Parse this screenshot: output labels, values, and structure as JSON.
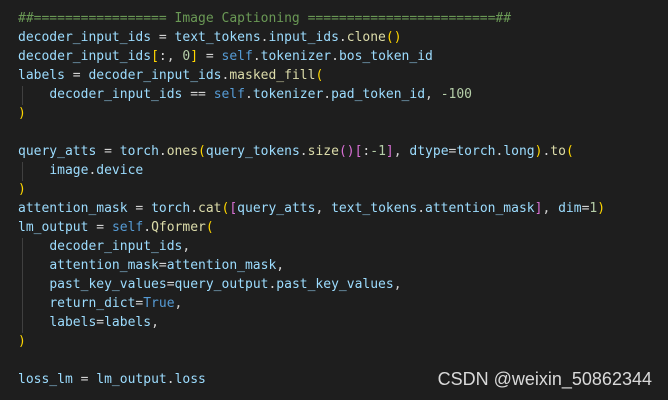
{
  "code": {
    "language": "python",
    "lines": [
      [
        {
          "t": "##================= Image Captioning ========================##",
          "c": "cm"
        }
      ],
      [
        {
          "t": "decoder_input_ids",
          "c": "vr"
        },
        {
          "t": " = ",
          "c": "op"
        },
        {
          "t": "text_tokens",
          "c": "vr"
        },
        {
          "t": ".",
          "c": "op"
        },
        {
          "t": "input_ids",
          "c": "vr"
        },
        {
          "t": ".",
          "c": "op"
        },
        {
          "t": "clone",
          "c": "fn"
        },
        {
          "t": "()",
          "c": "br1"
        }
      ],
      [
        {
          "t": "decoder_input_ids",
          "c": "vr"
        },
        {
          "t": "[",
          "c": "br1"
        },
        {
          "t": ":, ",
          "c": "op"
        },
        {
          "t": "0",
          "c": "nm"
        },
        {
          "t": "]",
          "c": "br1"
        },
        {
          "t": " = ",
          "c": "op"
        },
        {
          "t": "self",
          "c": "sf"
        },
        {
          "t": ".",
          "c": "op"
        },
        {
          "t": "tokenizer",
          "c": "vr"
        },
        {
          "t": ".",
          "c": "op"
        },
        {
          "t": "bos_token_id",
          "c": "vr"
        }
      ],
      [
        {
          "t": "labels",
          "c": "vr"
        },
        {
          "t": " = ",
          "c": "op"
        },
        {
          "t": "decoder_input_ids",
          "c": "vr"
        },
        {
          "t": ".",
          "c": "op"
        },
        {
          "t": "masked_fill",
          "c": "fn"
        },
        {
          "t": "(",
          "c": "br1"
        }
      ],
      [
        {
          "t": "    ",
          "c": "op"
        },
        {
          "t": "decoder_input_ids",
          "c": "vr"
        },
        {
          "t": " == ",
          "c": "op"
        },
        {
          "t": "self",
          "c": "sf"
        },
        {
          "t": ".",
          "c": "op"
        },
        {
          "t": "tokenizer",
          "c": "vr"
        },
        {
          "t": ".",
          "c": "op"
        },
        {
          "t": "pad_token_id",
          "c": "vr"
        },
        {
          "t": ", ",
          "c": "op"
        },
        {
          "t": "-100",
          "c": "nm"
        }
      ],
      [
        {
          "t": ")",
          "c": "br1"
        }
      ],
      [],
      [
        {
          "t": "query_atts",
          "c": "vr"
        },
        {
          "t": " = ",
          "c": "op"
        },
        {
          "t": "torch",
          "c": "vr"
        },
        {
          "t": ".",
          "c": "op"
        },
        {
          "t": "ones",
          "c": "fn"
        },
        {
          "t": "(",
          "c": "br1"
        },
        {
          "t": "query_tokens",
          "c": "vr"
        },
        {
          "t": ".",
          "c": "op"
        },
        {
          "t": "size",
          "c": "fn"
        },
        {
          "t": "()",
          "c": "br2"
        },
        {
          "t": "[",
          "c": "br2"
        },
        {
          "t": ":",
          "c": "op"
        },
        {
          "t": "-1",
          "c": "nm"
        },
        {
          "t": "]",
          "c": "br2"
        },
        {
          "t": ", ",
          "c": "op"
        },
        {
          "t": "dtype",
          "c": "pm"
        },
        {
          "t": "=",
          "c": "op"
        },
        {
          "t": "torch",
          "c": "vr"
        },
        {
          "t": ".",
          "c": "op"
        },
        {
          "t": "long",
          "c": "vr"
        },
        {
          "t": ")",
          "c": "br1"
        },
        {
          "t": ".",
          "c": "op"
        },
        {
          "t": "to",
          "c": "fn"
        },
        {
          "t": "(",
          "c": "br1"
        }
      ],
      [
        {
          "t": "    ",
          "c": "op"
        },
        {
          "t": "image",
          "c": "vr"
        },
        {
          "t": ".",
          "c": "op"
        },
        {
          "t": "device",
          "c": "vr"
        }
      ],
      [
        {
          "t": ")",
          "c": "br1"
        }
      ],
      [
        {
          "t": "attention_mask",
          "c": "vr"
        },
        {
          "t": " = ",
          "c": "op"
        },
        {
          "t": "torch",
          "c": "vr"
        },
        {
          "t": ".",
          "c": "op"
        },
        {
          "t": "cat",
          "c": "fn"
        },
        {
          "t": "(",
          "c": "br1"
        },
        {
          "t": "[",
          "c": "br2"
        },
        {
          "t": "query_atts",
          "c": "vr"
        },
        {
          "t": ", ",
          "c": "op"
        },
        {
          "t": "text_tokens",
          "c": "vr"
        },
        {
          "t": ".",
          "c": "op"
        },
        {
          "t": "attention_mask",
          "c": "vr"
        },
        {
          "t": "]",
          "c": "br2"
        },
        {
          "t": ", ",
          "c": "op"
        },
        {
          "t": "dim",
          "c": "pm"
        },
        {
          "t": "=",
          "c": "op"
        },
        {
          "t": "1",
          "c": "nm"
        },
        {
          "t": ")",
          "c": "br1"
        }
      ],
      [
        {
          "t": "lm_output",
          "c": "vr"
        },
        {
          "t": " = ",
          "c": "op"
        },
        {
          "t": "self",
          "c": "sf"
        },
        {
          "t": ".",
          "c": "op"
        },
        {
          "t": "Qformer",
          "c": "fn"
        },
        {
          "t": "(",
          "c": "br1"
        }
      ],
      [
        {
          "t": "    ",
          "c": "op"
        },
        {
          "t": "decoder_input_ids",
          "c": "vr"
        },
        {
          "t": ",",
          "c": "op"
        }
      ],
      [
        {
          "t": "    ",
          "c": "op"
        },
        {
          "t": "attention_mask",
          "c": "pm"
        },
        {
          "t": "=",
          "c": "op"
        },
        {
          "t": "attention_mask",
          "c": "vr"
        },
        {
          "t": ",",
          "c": "op"
        }
      ],
      [
        {
          "t": "    ",
          "c": "op"
        },
        {
          "t": "past_key_values",
          "c": "pm"
        },
        {
          "t": "=",
          "c": "op"
        },
        {
          "t": "query_output",
          "c": "vr"
        },
        {
          "t": ".",
          "c": "op"
        },
        {
          "t": "past_key_values",
          "c": "vr"
        },
        {
          "t": ",",
          "c": "op"
        }
      ],
      [
        {
          "t": "    ",
          "c": "op"
        },
        {
          "t": "return_dict",
          "c": "pm"
        },
        {
          "t": "=",
          "c": "op"
        },
        {
          "t": "True",
          "c": "sf"
        },
        {
          "t": ",",
          "c": "op"
        }
      ],
      [
        {
          "t": "    ",
          "c": "op"
        },
        {
          "t": "labels",
          "c": "pm"
        },
        {
          "t": "=",
          "c": "op"
        },
        {
          "t": "labels",
          "c": "vr"
        },
        {
          "t": ",",
          "c": "op"
        }
      ],
      [
        {
          "t": ")",
          "c": "br1"
        }
      ],
      [],
      [
        {
          "t": "loss_lm",
          "c": "vr"
        },
        {
          "t": " = ",
          "c": "op"
        },
        {
          "t": "lm_output",
          "c": "vr"
        },
        {
          "t": ".",
          "c": "op"
        },
        {
          "t": "loss",
          "c": "vr"
        }
      ]
    ]
  },
  "watermark": "CSDN @weixin_50862344",
  "colors": {
    "background": "#1e1e1e",
    "comment": "#6a9955",
    "variable": "#9cdcfe",
    "function": "#dcdcaa",
    "keyword": "#569cd6",
    "number": "#b5cea8",
    "bracket_level1": "#ffd700",
    "bracket_level2": "#da70d6"
  }
}
